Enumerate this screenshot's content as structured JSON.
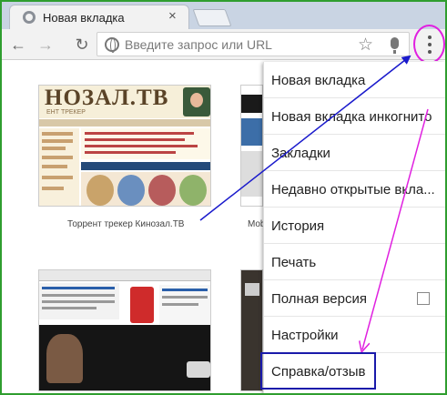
{
  "browser": {
    "tab": {
      "title": "Новая вкладка",
      "close_glyph": "×",
      "favicon": "globe-icon"
    },
    "toolbar": {
      "back_glyph": "←",
      "forward_glyph": "→",
      "reload_glyph": "↻",
      "omnibox_placeholder": "Введите запрос или URL",
      "star_glyph": "☆"
    }
  },
  "thumbnails": [
    {
      "label": "Торрент трекер Кинозал.ТВ",
      "logo_text": "НОЗАЛ.ТВ",
      "sub_text": "ЕНТ ТРЕКЕР"
    },
    {
      "label": "Mob"
    }
  ],
  "menu": {
    "items": [
      {
        "label": "Новая вкладка"
      },
      {
        "label": "Новая вкладка инкогнито"
      },
      {
        "label": "Закладки"
      },
      {
        "label": "Недавно открытые вкла..."
      },
      {
        "label": "История"
      },
      {
        "label": "Печать"
      },
      {
        "label": "Полная версия",
        "checked": false
      },
      {
        "label": "Настройки"
      },
      {
        "label": "Справка/отзыв",
        "highlighted": true
      }
    ]
  },
  "colors": {
    "frame_border": "#2f9e2f",
    "highlight_box": "#1a1aaa",
    "arrow_blue": "#1a1acc",
    "arrow_magenta": "#e020e0"
  }
}
